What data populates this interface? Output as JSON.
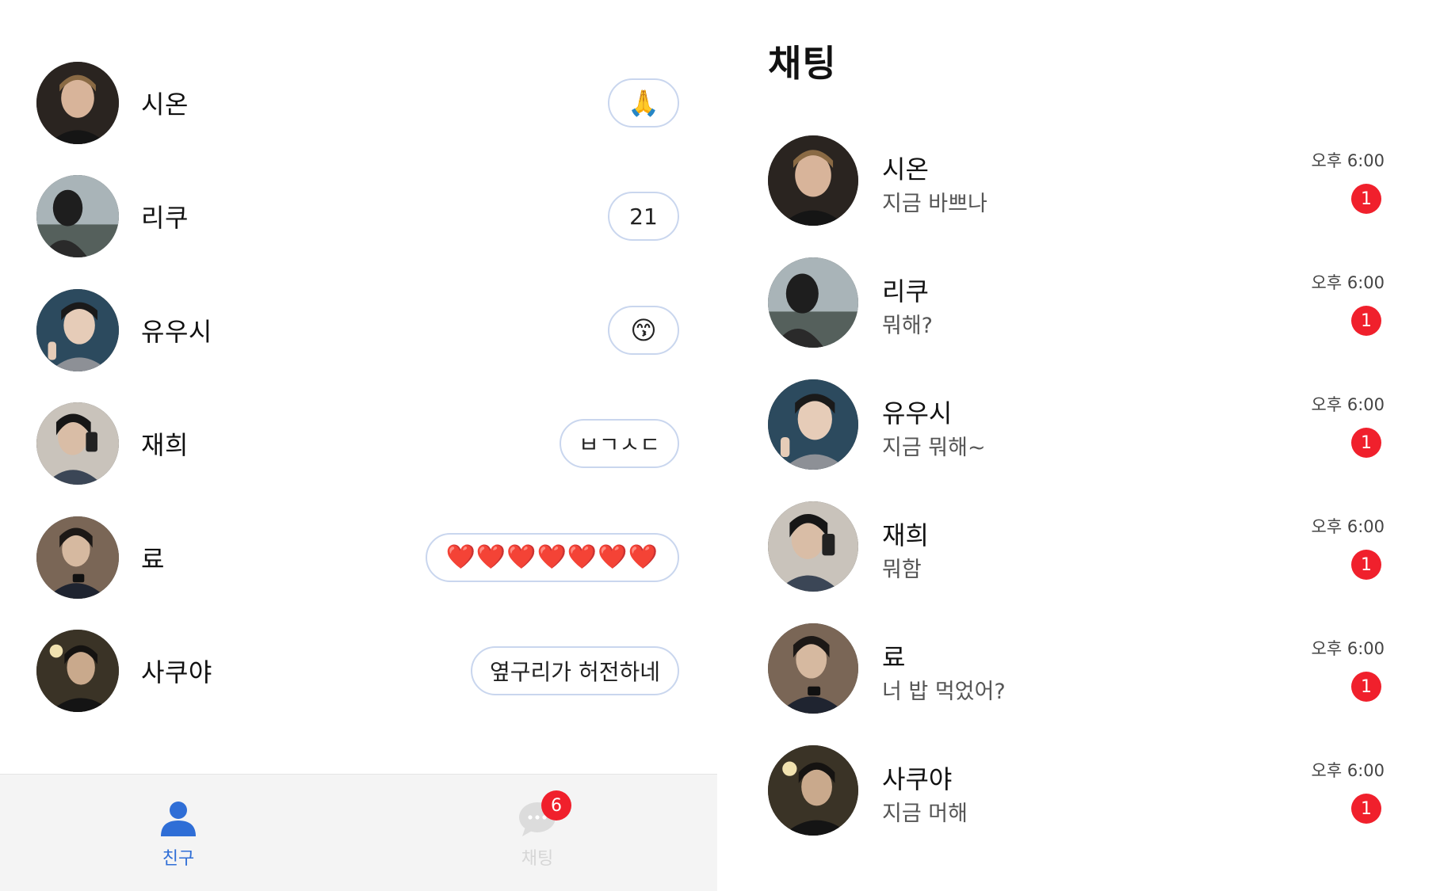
{
  "friends_screen": {
    "friends": [
      {
        "name": "시온",
        "status": "🙏",
        "status_kind": "emoji",
        "avatar_tone": "#3a2e27"
      },
      {
        "name": "리쿠",
        "status": "21",
        "status_kind": "text",
        "avatar_tone": "#6b7a80"
      },
      {
        "name": "유우시",
        "status": "😙",
        "status_kind": "emoji",
        "avatar_tone": "#2f4a5c"
      },
      {
        "name": "재희",
        "status": "ㅂㄱㅅㄷ",
        "status_kind": "text",
        "avatar_tone": "#4a4a4a"
      },
      {
        "name": "료",
        "status": "❤️❤️❤️❤️❤️❤️❤️",
        "status_kind": "hearts",
        "avatar_tone": "#6a5a4c"
      },
      {
        "name": "사쿠야",
        "status": "옆구리가 허전하네",
        "status_kind": "text",
        "avatar_tone": "#2c2a26"
      }
    ],
    "tabbar": {
      "friends_label": "친구",
      "chat_label": "채팅",
      "chat_badge": "6",
      "active_color": "#2f6ed6",
      "inactive_color": "#d6d6d6"
    }
  },
  "chat_screen": {
    "title": "채팅",
    "chats": [
      {
        "name": "시온",
        "preview": "지금 바쁘나",
        "time": "오후 6:00",
        "unread": "1"
      },
      {
        "name": "리쿠",
        "preview": "뭐해?",
        "time": "오후 6:00",
        "unread": "1"
      },
      {
        "name": "유우시",
        "preview": "지금 뭐해~",
        "time": "오후 6:00",
        "unread": "1"
      },
      {
        "name": "재희",
        "preview": "뭐함",
        "time": "오후 6:00",
        "unread": "1"
      },
      {
        "name": "료",
        "preview": "너 밥 먹었어?",
        "time": "오후 6:00",
        "unread": "1"
      },
      {
        "name": "사쿠야",
        "preview": "지금 머해",
        "time": "오후 6:00",
        "unread": "1"
      }
    ],
    "badge_color": "#f0202c"
  }
}
